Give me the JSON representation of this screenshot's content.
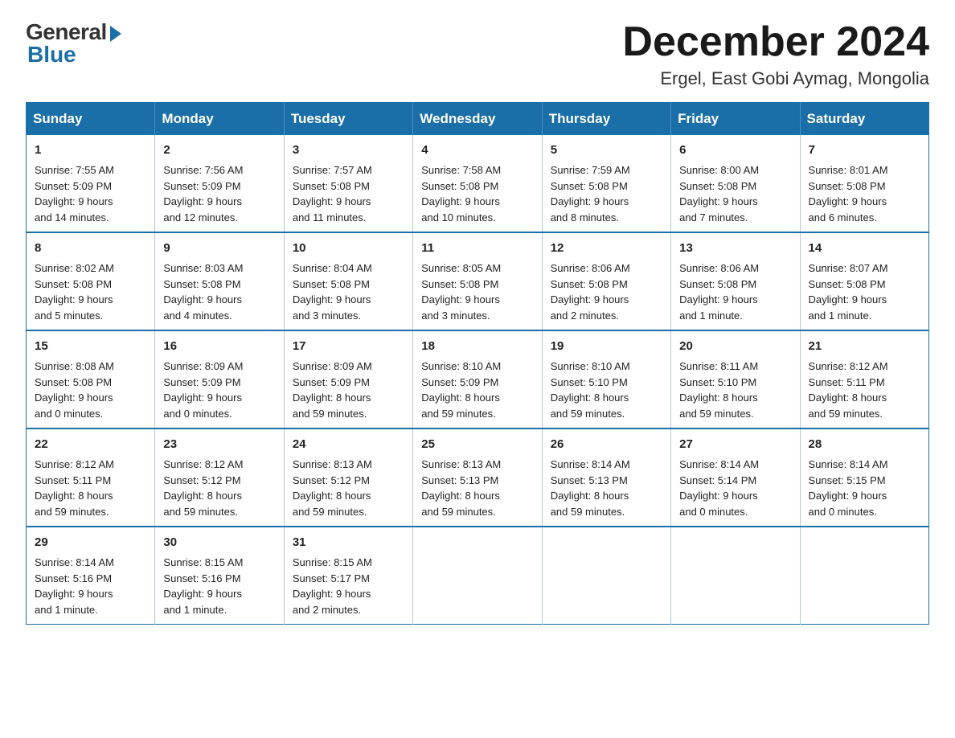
{
  "logo": {
    "general": "General",
    "blue": "Blue"
  },
  "title": "December 2024",
  "subtitle": "Ergel, East Gobi Aymag, Mongolia",
  "days_of_week": [
    "Sunday",
    "Monday",
    "Tuesday",
    "Wednesday",
    "Thursday",
    "Friday",
    "Saturday"
  ],
  "weeks": [
    [
      {
        "day": "1",
        "sunrise": "7:55 AM",
        "sunset": "5:09 PM",
        "daylight": "9 hours and 14 minutes."
      },
      {
        "day": "2",
        "sunrise": "7:56 AM",
        "sunset": "5:09 PM",
        "daylight": "9 hours and 12 minutes."
      },
      {
        "day": "3",
        "sunrise": "7:57 AM",
        "sunset": "5:08 PM",
        "daylight": "9 hours and 11 minutes."
      },
      {
        "day": "4",
        "sunrise": "7:58 AM",
        "sunset": "5:08 PM",
        "daylight": "9 hours and 10 minutes."
      },
      {
        "day": "5",
        "sunrise": "7:59 AM",
        "sunset": "5:08 PM",
        "daylight": "9 hours and 8 minutes."
      },
      {
        "day": "6",
        "sunrise": "8:00 AM",
        "sunset": "5:08 PM",
        "daylight": "9 hours and 7 minutes."
      },
      {
        "day": "7",
        "sunrise": "8:01 AM",
        "sunset": "5:08 PM",
        "daylight": "9 hours and 6 minutes."
      }
    ],
    [
      {
        "day": "8",
        "sunrise": "8:02 AM",
        "sunset": "5:08 PM",
        "daylight": "9 hours and 5 minutes."
      },
      {
        "day": "9",
        "sunrise": "8:03 AM",
        "sunset": "5:08 PM",
        "daylight": "9 hours and 4 minutes."
      },
      {
        "day": "10",
        "sunrise": "8:04 AM",
        "sunset": "5:08 PM",
        "daylight": "9 hours and 3 minutes."
      },
      {
        "day": "11",
        "sunrise": "8:05 AM",
        "sunset": "5:08 PM",
        "daylight": "9 hours and 3 minutes."
      },
      {
        "day": "12",
        "sunrise": "8:06 AM",
        "sunset": "5:08 PM",
        "daylight": "9 hours and 2 minutes."
      },
      {
        "day": "13",
        "sunrise": "8:06 AM",
        "sunset": "5:08 PM",
        "daylight": "9 hours and 1 minute."
      },
      {
        "day": "14",
        "sunrise": "8:07 AM",
        "sunset": "5:08 PM",
        "daylight": "9 hours and 1 minute."
      }
    ],
    [
      {
        "day": "15",
        "sunrise": "8:08 AM",
        "sunset": "5:08 PM",
        "daylight": "9 hours and 0 minutes."
      },
      {
        "day": "16",
        "sunrise": "8:09 AM",
        "sunset": "5:09 PM",
        "daylight": "9 hours and 0 minutes."
      },
      {
        "day": "17",
        "sunrise": "8:09 AM",
        "sunset": "5:09 PM",
        "daylight": "8 hours and 59 minutes."
      },
      {
        "day": "18",
        "sunrise": "8:10 AM",
        "sunset": "5:09 PM",
        "daylight": "8 hours and 59 minutes."
      },
      {
        "day": "19",
        "sunrise": "8:10 AM",
        "sunset": "5:10 PM",
        "daylight": "8 hours and 59 minutes."
      },
      {
        "day": "20",
        "sunrise": "8:11 AM",
        "sunset": "5:10 PM",
        "daylight": "8 hours and 59 minutes."
      },
      {
        "day": "21",
        "sunrise": "8:12 AM",
        "sunset": "5:11 PM",
        "daylight": "8 hours and 59 minutes."
      }
    ],
    [
      {
        "day": "22",
        "sunrise": "8:12 AM",
        "sunset": "5:11 PM",
        "daylight": "8 hours and 59 minutes."
      },
      {
        "day": "23",
        "sunrise": "8:12 AM",
        "sunset": "5:12 PM",
        "daylight": "8 hours and 59 minutes."
      },
      {
        "day": "24",
        "sunrise": "8:13 AM",
        "sunset": "5:12 PM",
        "daylight": "8 hours and 59 minutes."
      },
      {
        "day": "25",
        "sunrise": "8:13 AM",
        "sunset": "5:13 PM",
        "daylight": "8 hours and 59 minutes."
      },
      {
        "day": "26",
        "sunrise": "8:14 AM",
        "sunset": "5:13 PM",
        "daylight": "8 hours and 59 minutes."
      },
      {
        "day": "27",
        "sunrise": "8:14 AM",
        "sunset": "5:14 PM",
        "daylight": "9 hours and 0 minutes."
      },
      {
        "day": "28",
        "sunrise": "8:14 AM",
        "sunset": "5:15 PM",
        "daylight": "9 hours and 0 minutes."
      }
    ],
    [
      {
        "day": "29",
        "sunrise": "8:14 AM",
        "sunset": "5:16 PM",
        "daylight": "9 hours and 1 minute."
      },
      {
        "day": "30",
        "sunrise": "8:15 AM",
        "sunset": "5:16 PM",
        "daylight": "9 hours and 1 minute."
      },
      {
        "day": "31",
        "sunrise": "8:15 AM",
        "sunset": "5:17 PM",
        "daylight": "9 hours and 2 minutes."
      },
      null,
      null,
      null,
      null
    ]
  ],
  "labels": {
    "sunrise": "Sunrise:",
    "sunset": "Sunset:",
    "daylight": "Daylight:"
  }
}
